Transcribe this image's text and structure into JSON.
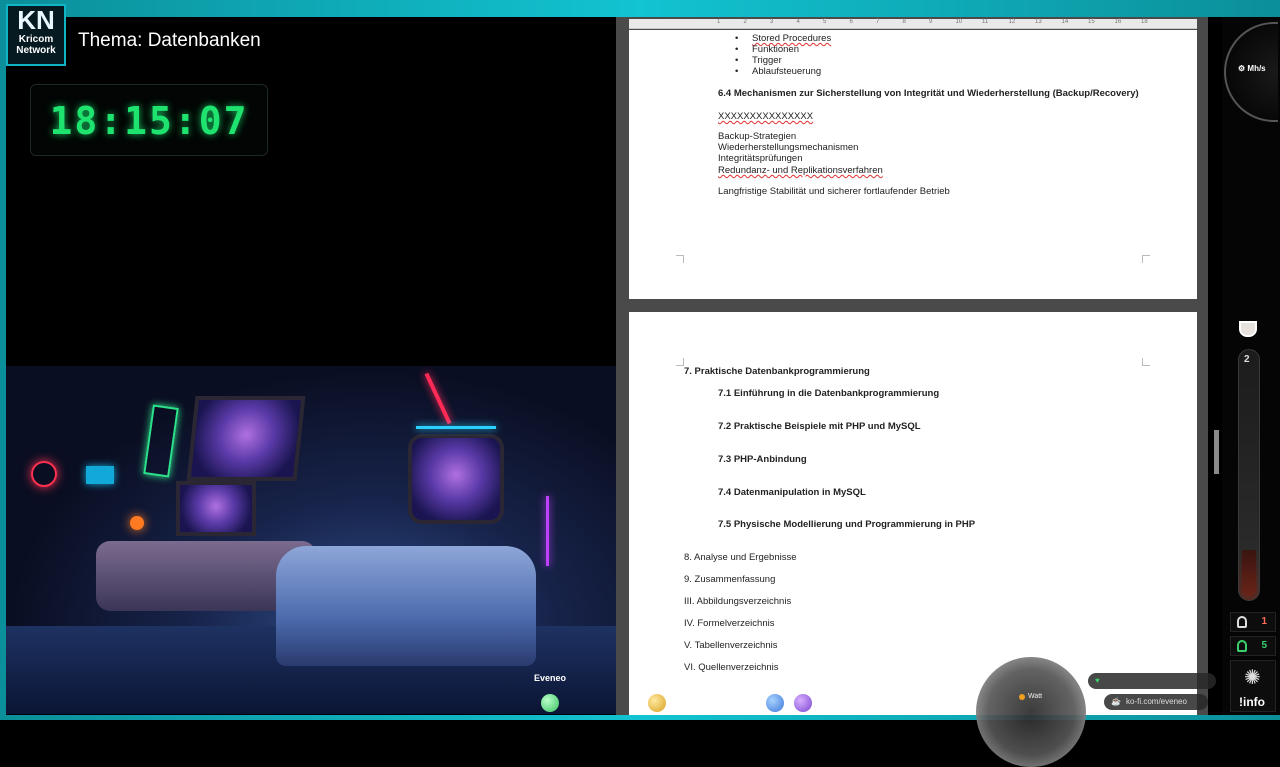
{
  "overlay": {
    "logo_main": "KN",
    "logo_line1": "Kricom",
    "logo_line2": "Network",
    "topic": "Thema: Datenbanken",
    "clock": "18:15:07",
    "streamer_name": "Eveneo",
    "kofi": "ko-fi.com/eveneo",
    "watt_label": "Watt",
    "mhs_label": "Mh/s",
    "meter_value": "2",
    "viewer_count_1": "1",
    "viewer_count_2": "5",
    "info_label": "!info"
  },
  "document": {
    "ruler_ticks": [
      "1",
      "2",
      "3",
      "4",
      "5",
      "6",
      "7",
      "8",
      "9",
      "10",
      "11",
      "12",
      "13",
      "14",
      "15",
      "16",
      "18"
    ],
    "page1": {
      "bullets": [
        "Stored Procedures",
        "Funktionen",
        "Trigger",
        "Ablaufsteuerung"
      ],
      "heading": "6.4 Mechanismen zur Sicherstellung von Integrität und Wiederherstellung (Backup/Recovery)",
      "placeholder": "XXXXXXXXXXXXXXX",
      "items": [
        "Backup-Strategien",
        "Wiederherstellungsmechanismen",
        "Integritätsprüfungen",
        "Redundanz- und Replikationsverfahren"
      ],
      "closing": "Langfristige Stabilität und sicherer fortlaufender Betrieb"
    },
    "page2": {
      "chapter": "7. Praktische Datenbankprogrammierung",
      "sections": [
        "7.1 Einführung in die Datenbankprogrammierung",
        "7.2 Praktische Beispiele mit PHP und MySQL",
        "7.3 PHP-Anbindung",
        "7.4 Datenmanipulation in MySQL",
        "7.5 Physische Modellierung und Programmierung in PHP"
      ],
      "toc": [
        "8. Analyse und Ergebnisse",
        "9. Zusammenfassung",
        "III. Abbildungsverzeichnis",
        "IV. Formelverzeichnis",
        "V. Tabellenverzeichnis",
        "VI. Quellenverzeichnis"
      ]
    }
  },
  "colors": {
    "frame": "#12c3d1",
    "clock": "#1ee36f",
    "viewer_1": "#ff6a5a",
    "viewer_2": "#3ad16a"
  }
}
